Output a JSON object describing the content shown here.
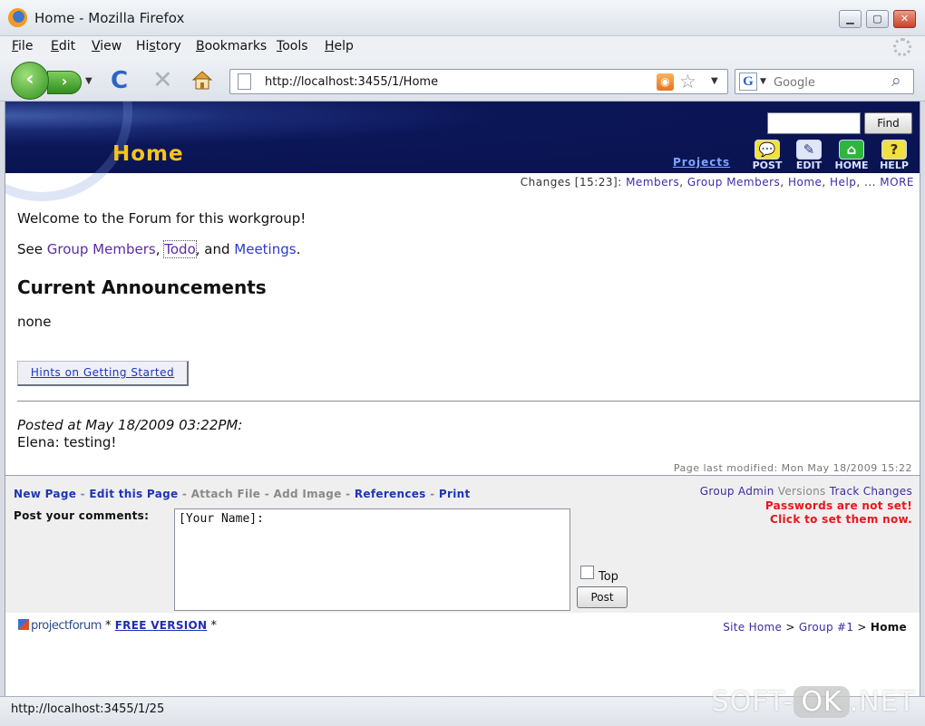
{
  "window": {
    "title": "Home - Mozilla Firefox",
    "buttons": {
      "minimize": "▁",
      "maximize": "▢",
      "close": "✕"
    }
  },
  "menubar": {
    "items": [
      {
        "key": "F",
        "rest": "ile"
      },
      {
        "key": "E",
        "rest": "dit"
      },
      {
        "key": "V",
        "rest": "iew"
      },
      {
        "key": "",
        "pre": "Hi",
        "mid": "s",
        "post": "tory"
      },
      {
        "key": "B",
        "rest": "ookmarks"
      },
      {
        "key": "T",
        "rest": "ools"
      },
      {
        "key": "H",
        "rest": "elp"
      }
    ]
  },
  "navbar": {
    "back_icon": "‹",
    "forward_icon": "›",
    "forward_drop": "▼",
    "reload_icon": "C",
    "stop_icon": "✕",
    "url": "http://localhost:3455/1/Home",
    "rss_icon": "◉",
    "star_icon": "☆",
    "url_drop": "▼",
    "search_engine_icon": "G",
    "search_drop": "▼",
    "search_placeholder": "Google",
    "search_icon": "⌕"
  },
  "banner": {
    "title": "Home",
    "find_button": "Find",
    "projects_link": "Projects",
    "tools": [
      {
        "label": "POST",
        "icon": "💬"
      },
      {
        "label": "EDIT",
        "icon": "✎"
      },
      {
        "label": "HOME",
        "icon": "⌂"
      },
      {
        "label": "HELP",
        "icon": "?"
      }
    ]
  },
  "changes": {
    "prefix": "Changes [15:23]: ",
    "links": [
      "Members",
      "Group Members",
      "Home",
      "Help"
    ],
    "ellipsis": ", ... ",
    "more": "MORE"
  },
  "body": {
    "welcome": "Welcome to the Forum for this workgroup!",
    "see_prefix": "See ",
    "see_links": [
      "Group Members",
      "Todo",
      "Meetings"
    ],
    "see_and": ", and ",
    "see_end": ".",
    "announcements_heading": "Current Announcements",
    "announcements_text": "none",
    "hints_button": "Hints on Getting Started",
    "posted_at": "Posted at May 18/2009 03:22PM:",
    "post_body": "Elena: testing!",
    "last_modified": "Page last modified: Mon May 18/2009 15:22"
  },
  "footer": {
    "actions": {
      "new_page": "New Page",
      "edit_page": "Edit this Page",
      "attach_file": "Attach File",
      "add_image": "Add Image",
      "references": "References",
      "print": "Print",
      "sep": " - "
    },
    "admin": {
      "group_admin": "Group Admin",
      "versions": "Versions",
      "track_changes": "Track Changes"
    },
    "password_warning_1": "Passwords are not set!",
    "password_warning_2": "Click to set them now.",
    "comment_label": "Post your comments:",
    "comment_value": "[Your Name]:",
    "top_label": "Top",
    "post_button": "Post"
  },
  "bottom": {
    "logo_text": "projectforum",
    "free_version": "FREE VERSION",
    "star": "*",
    "breadcrumb": {
      "site_home": "Site Home",
      "group": "Group #1",
      "current": "Home",
      "sep": " > "
    }
  },
  "statusbar": {
    "text": "http://localhost:3455/1/25"
  },
  "watermark": {
    "pre": "SOFT-",
    "ok": "OK",
    "post": ".NET"
  }
}
